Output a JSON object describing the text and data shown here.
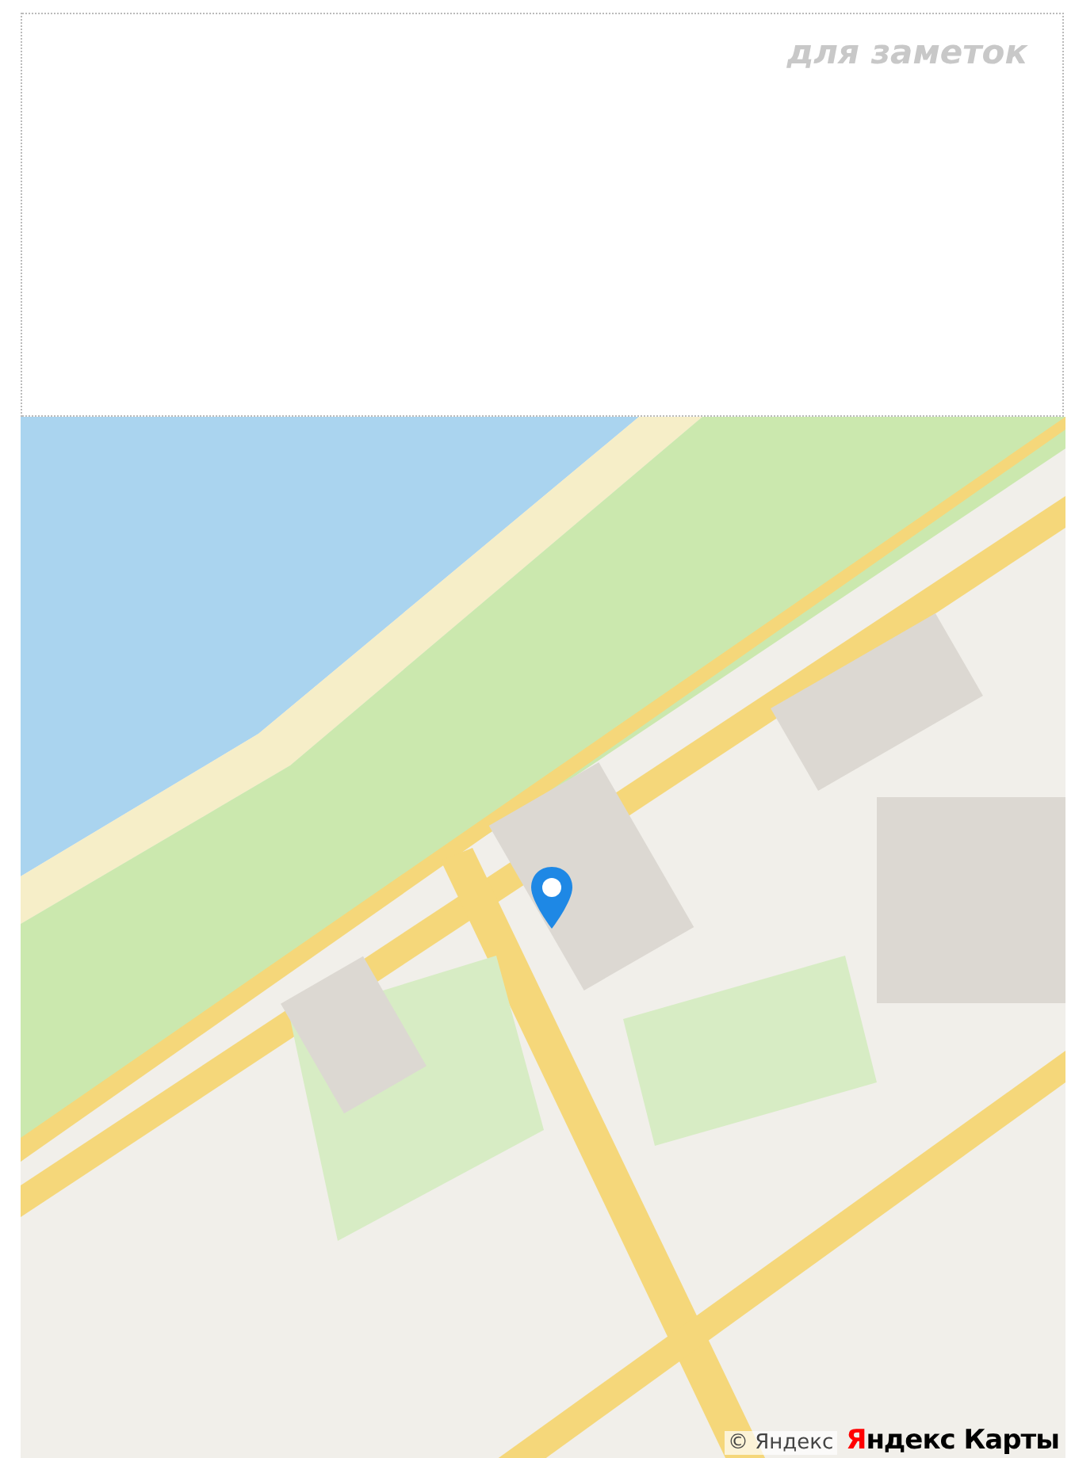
{
  "notes": {
    "placeholder": "для заметок"
  },
  "map": {
    "kind": "picture",
    "copyright": "© Яндекс",
    "logo": "Яндекс Карты"
  }
}
